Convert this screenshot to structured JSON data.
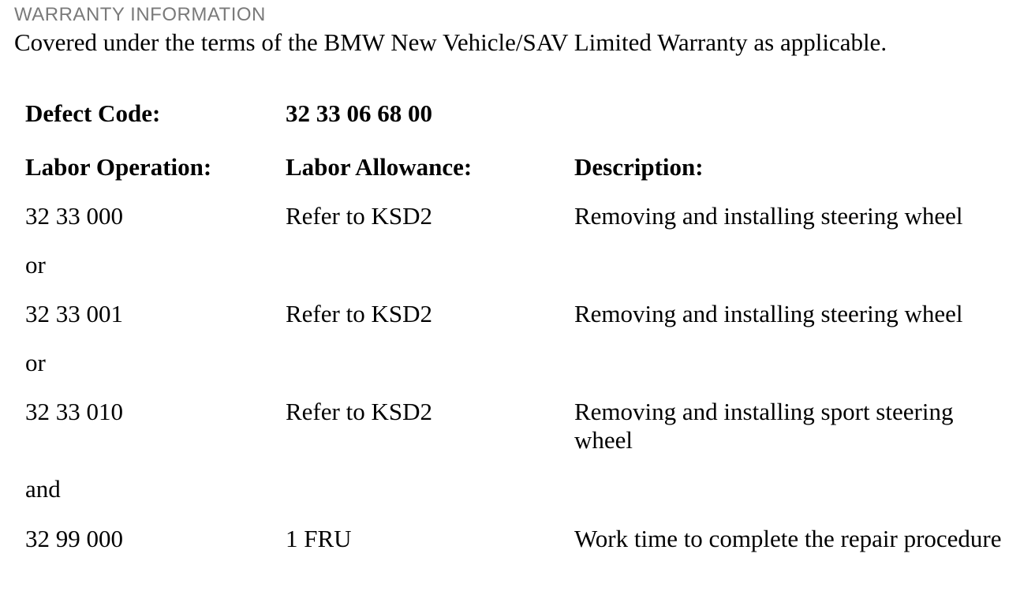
{
  "section_title": "WARRANTY INFORMATION",
  "intro": "Covered under the terms of the BMW New Vehicle/SAV Limited Warranty as applicable.",
  "defect": {
    "label": "Defect Code:",
    "value": "32 33 06 68 00"
  },
  "headers": {
    "labor_operation": "Labor Operation:",
    "labor_allowance": "Labor Allowance:",
    "description": "Description:"
  },
  "rows": [
    {
      "operation": "32 33 000",
      "allowance": "Refer to KSD2",
      "description": "Removing and installing steering wheel"
    },
    {
      "connector": "or"
    },
    {
      "operation": "32 33 001",
      "allowance": "Refer to KSD2",
      "description": "Removing and installing steering wheel"
    },
    {
      "connector": "or"
    },
    {
      "operation": "32 33 010",
      "allowance": "Refer to KSD2",
      "description": "Removing and installing sport steering wheel"
    },
    {
      "connector": "and"
    },
    {
      "operation": "32 99 000",
      "allowance": "1 FRU",
      "description": "Work time to complete the repair procedure"
    }
  ]
}
